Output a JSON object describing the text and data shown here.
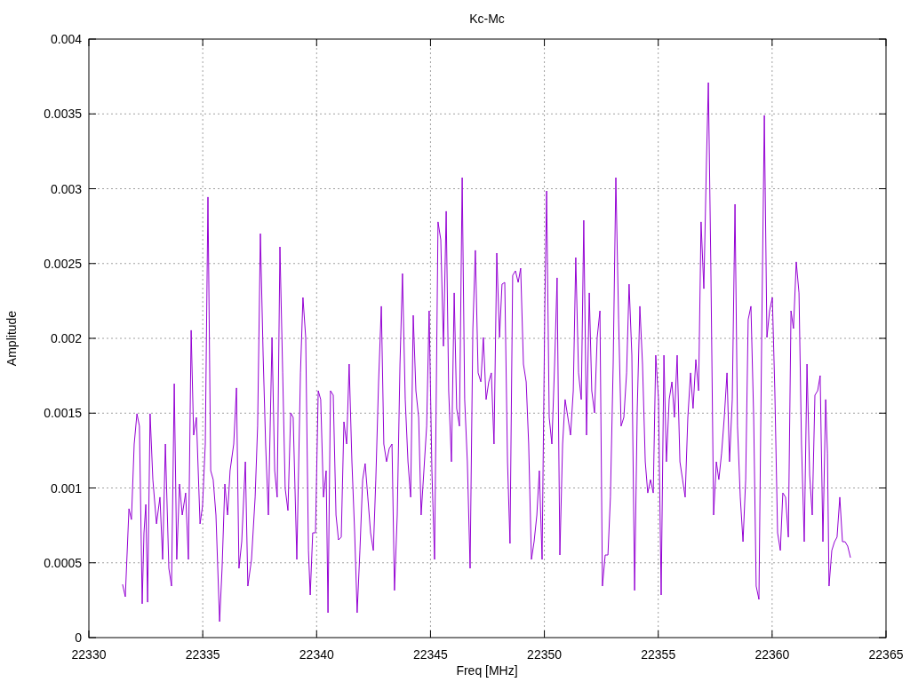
{
  "chart_data": {
    "type": "line",
    "title": "Kc-Mc",
    "xlabel": "Freq [MHz]",
    "ylabel": "Amplitude",
    "xlim": [
      22330,
      22365
    ],
    "ylim": [
      0,
      0.004
    ],
    "grid": true,
    "xticks": [
      22330,
      22335,
      22340,
      22345,
      22350,
      22355,
      22360,
      22365
    ],
    "yticks": [
      0.004,
      0.0035,
      0.003,
      0.0025,
      0.002,
      0.0015,
      0.001,
      0.0005,
      0
    ],
    "x": [
      22331.48,
      22331.6,
      22331.76,
      22331.87,
      22331.99,
      22332.11,
      22332.22,
      22332.34,
      22332.42,
      22332.5,
      22332.58,
      22332.69,
      22332.81,
      22332.97,
      22333.12,
      22333.24,
      22333.36,
      22333.51,
      22333.63,
      22333.75,
      22333.86,
      22333.98,
      22334.1,
      22334.25,
      22334.37,
      22334.49,
      22334.6,
      22334.72,
      22334.88,
      22334.99,
      22335.11,
      22335.23,
      22335.35,
      22335.46,
      22335.58,
      22335.74,
      22335.85,
      22335.97,
      22336.09,
      22336.2,
      22336.36,
      22336.48,
      22336.59,
      22336.71,
      22336.87,
      22336.98,
      22337.14,
      22337.3,
      22337.41,
      22337.53,
      22337.65,
      22337.76,
      22337.88,
      22338.04,
      22338.16,
      22338.27,
      22338.39,
      22338.51,
      22338.62,
      22338.74,
      22338.86,
      22338.97,
      22339.13,
      22339.29,
      22339.4,
      22339.52,
      22339.64,
      22339.72,
      22339.83,
      22339.95,
      22340.07,
      22340.18,
      22340.3,
      22340.42,
      22340.5,
      22340.61,
      22340.73,
      22340.85,
      22340.96,
      22341.08,
      22341.2,
      22341.32,
      22341.43,
      22341.55,
      22341.67,
      22341.78,
      22341.9,
      22342.02,
      22342.13,
      22342.25,
      22342.37,
      22342.49,
      22342.6,
      22342.72,
      22342.84,
      22342.95,
      22343.07,
      22343.19,
      22343.31,
      22343.42,
      22343.54,
      22343.66,
      22343.77,
      22343.89,
      22344.01,
      22344.13,
      22344.24,
      22344.36,
      22344.48,
      22344.59,
      22344.71,
      22344.83,
      22344.94,
      22345.06,
      22345.18,
      22345.33,
      22345.45,
      22345.57,
      22345.69,
      22345.8,
      22345.92,
      22346.04,
      22346.15,
      22346.27,
      22346.39,
      22346.5,
      22346.62,
      22346.74,
      22346.86,
      22346.97,
      22347.09,
      22347.21,
      22347.32,
      22347.44,
      22347.56,
      22347.67,
      22347.79,
      22347.91,
      22348.03,
      22348.14,
      22348.26,
      22348.38,
      22348.49,
      22348.61,
      22348.73,
      22348.85,
      22348.96,
      22349.08,
      22349.2,
      22349.31,
      22349.43,
      22349.55,
      22349.67,
      22349.78,
      22349.9,
      22350.02,
      22350.1,
      22350.21,
      22350.33,
      22350.45,
      22350.56,
      22350.68,
      22350.8,
      22350.91,
      22351.03,
      22351.15,
      22351.27,
      22351.38,
      22351.5,
      22351.62,
      22351.73,
      22351.85,
      22351.97,
      22352.08,
      22352.2,
      22352.32,
      22352.44,
      22352.55,
      22352.67,
      22352.79,
      22352.9,
      22353.02,
      22353.14,
      22353.26,
      22353.37,
      22353.49,
      22353.61,
      22353.72,
      22353.84,
      22353.96,
      22354.08,
      22354.19,
      22354.31,
      22354.43,
      22354.54,
      22354.66,
      22354.78,
      22354.89,
      22355.01,
      22355.13,
      22355.25,
      22355.36,
      22355.48,
      22355.6,
      22355.71,
      22355.83,
      22355.95,
      22356.07,
      22356.18,
      22356.3,
      22356.42,
      22356.53,
      22356.65,
      22356.77,
      22356.88,
      22357.0,
      22357.12,
      22357.2,
      22357.31,
      22357.43,
      22357.55,
      22357.66,
      22357.78,
      22357.9,
      22358.02,
      22358.13,
      22358.25,
      22358.37,
      22358.48,
      22358.6,
      22358.72,
      22358.84,
      22358.95,
      22359.07,
      22359.19,
      22359.3,
      22359.42,
      22359.54,
      22359.66,
      22359.77,
      22359.89,
      22360.01,
      22360.12,
      22360.24,
      22360.36,
      22360.47,
      22360.59,
      22360.71,
      22360.83,
      22360.94,
      22361.06,
      22361.18,
      22361.29,
      22361.41,
      22361.53,
      22361.65,
      22361.76,
      22361.88,
      22362.0,
      22362.11,
      22362.23,
      22362.35,
      22362.43,
      22362.5,
      22362.62,
      22362.74,
      22362.85,
      22362.97,
      22363.09,
      22363.2,
      22363.32,
      22363.44
    ],
    "series": [
      {
        "color": "#9400d3",
        "values": [
          0.000356,
          0.000273,
          0.000861,
          0.000789,
          0.001294,
          0.001496,
          0.001413,
          0.000226,
          0.0007,
          0.00089,
          0.000237,
          0.001496,
          0.001056,
          0.00076,
          0.000938,
          0.000522,
          0.001294,
          0.000463,
          0.000344,
          0.001697,
          0.000522,
          0.001027,
          0.000819,
          0.000967,
          0.000522,
          0.002054,
          0.001353,
          0.001472,
          0.00076,
          0.000878,
          0.001294,
          0.002944,
          0.001116,
          0.001056,
          0.000819,
          0.000107,
          0.000463,
          0.001027,
          0.000819,
          0.001116,
          0.001294,
          0.001668,
          0.000463,
          0.000641,
          0.001175,
          0.000344,
          0.000522,
          0.000938,
          0.001413,
          0.0027,
          0.001887,
          0.001294,
          0.000819,
          0.002006,
          0.001116,
          0.000938,
          0.002611,
          0.001769,
          0.000997,
          0.000849,
          0.001502,
          0.001472,
          0.000522,
          0.001769,
          0.002273,
          0.002006,
          0.000582,
          0.000285,
          0.0007,
          0.0007,
          0.00165,
          0.001591,
          0.000938,
          0.001116,
          0.000166,
          0.00165,
          0.00162,
          0.000819,
          0.000653,
          0.000671,
          0.001442,
          0.001294,
          0.001828,
          0.001175,
          0.0007,
          0.000166,
          0.000582,
          0.001056,
          0.001163,
          0.000938,
          0.0007,
          0.000582,
          0.001056,
          0.001709,
          0.002214,
          0.001294,
          0.001175,
          0.001264,
          0.001294,
          0.000315,
          0.000819,
          0.001828,
          0.002433,
          0.001591,
          0.001175,
          0.000938,
          0.002154,
          0.00165,
          0.001472,
          0.000819,
          0.001116,
          0.001413,
          0.002184,
          0.001116,
          0.000522,
          0.002778,
          0.002659,
          0.001947,
          0.002849,
          0.00165,
          0.001175,
          0.002303,
          0.001531,
          0.001413,
          0.003074,
          0.001591,
          0.001175,
          0.000463,
          0.002065,
          0.002588,
          0.001769,
          0.001709,
          0.002006,
          0.001591,
          0.001709,
          0.001769,
          0.001294,
          0.00257,
          0.002006,
          0.002362,
          0.002374,
          0.001175,
          0.000629,
          0.002421,
          0.002451,
          0.002374,
          0.002469,
          0.001828,
          0.001709,
          0.001294,
          0.000522,
          0.000641,
          0.000819,
          0.001116,
          0.000522,
          0.002214,
          0.002985,
          0.001472,
          0.001294,
          0.001828,
          0.002404,
          0.000552,
          0.001294,
          0.001591,
          0.001472,
          0.001353,
          0.00165,
          0.00254,
          0.001769,
          0.001591,
          0.002789,
          0.001353,
          0.002303,
          0.00165,
          0.001502,
          0.002006,
          0.002184,
          0.000344,
          0.000552,
          0.000552,
          0.000938,
          0.001828,
          0.003074,
          0.002125,
          0.001413,
          0.001472,
          0.001769,
          0.002362,
          0.001887,
          0.000315,
          0.001531,
          0.002214,
          0.001828,
          0.001175,
          0.000967,
          0.001056,
          0.000967,
          0.001887,
          0.001591,
          0.000285,
          0.001887,
          0.001175,
          0.001591,
          0.001709,
          0.001472,
          0.001887,
          0.001175,
          0.001056,
          0.000938,
          0.001472,
          0.001769,
          0.001531,
          0.001858,
          0.00165,
          0.002778,
          0.002332,
          0.003193,
          0.003709,
          0.002481,
          0.000819,
          0.001175,
          0.001056,
          0.001234,
          0.001472,
          0.001769,
          0.001175,
          0.001591,
          0.002896,
          0.001413,
          0.000938,
          0.000641,
          0.001056,
          0.002125,
          0.002214,
          0.001472,
          0.000344,
          0.000255,
          0.002006,
          0.00349,
          0.002006,
          0.002184,
          0.002273,
          0.00165,
          0.0007,
          0.000582,
          0.000967,
          0.000938,
          0.000671,
          0.002184,
          0.002065,
          0.002511,
          0.002303,
          0.001294,
          0.000641,
          0.001828,
          0.001086,
          0.000819,
          0.00162,
          0.00165,
          0.001751,
          0.000641,
          0.001591,
          0.001234,
          0.000344,
          0.000582,
          0.000641,
          0.000671,
          0.000938,
          0.000641,
          0.000641,
          0.000611,
          0.000534
        ]
      }
    ]
  }
}
